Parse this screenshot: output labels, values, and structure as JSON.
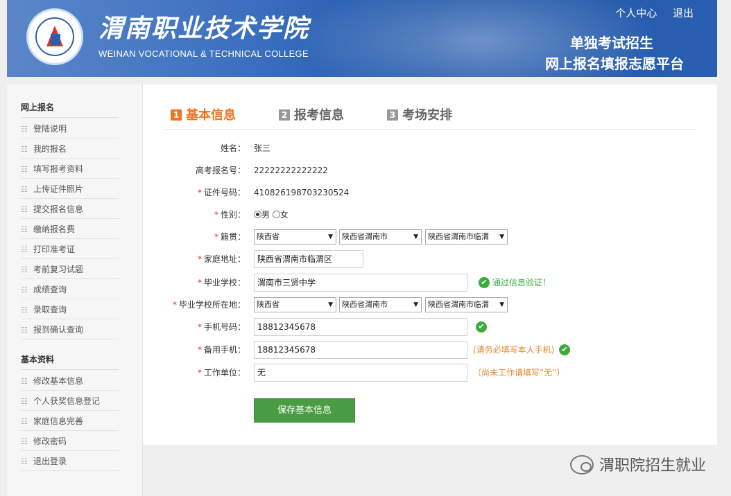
{
  "header": {
    "college_cn": "渭南职业技术学院",
    "college_en": "WEINAN VOCATIONAL & TECHNICAL COLLEGE",
    "links": [
      "个人中心",
      "退出"
    ],
    "slogan_line1": "单独考试招生",
    "slogan_line2": "网上报名填报志愿平台"
  },
  "sidebar": {
    "section1_title": "网上报名",
    "section1_items": [
      "登陆说明",
      "我的报名",
      "填写报考资料",
      "上传证件照片",
      "提交报名信息",
      "缴纳报名费",
      "打印准考证",
      "考前复习试题",
      "成绩查询",
      "录取查询",
      "报到确认查询"
    ],
    "section2_title": "基本资料",
    "section2_items": [
      "修改基本信息",
      "个人获奖信息登记",
      "家庭信息完善",
      "修改密码",
      "退出登录"
    ]
  },
  "steps": [
    {
      "num": "1",
      "label": "基本信息"
    },
    {
      "num": "2",
      "label": "报考信息"
    },
    {
      "num": "3",
      "label": "考场安排"
    }
  ],
  "form": {
    "name_label": "姓名：",
    "name_value": "张三",
    "exam_no_label": "高考报名号：",
    "exam_no_value": "22222222222222",
    "id_label": "证件号码：",
    "id_value": "410826198703230524",
    "gender_label": "性别：",
    "gender_male": "男",
    "gender_female": "女",
    "native_label": "籍贯：",
    "native_province": "陕西省",
    "native_city": "陕西省渭南市",
    "native_district": "陕西省渭南市临渭",
    "address_label": "家庭地址：",
    "address_value": "陕西省渭南市临渭区",
    "school_label": "毕业学校：",
    "school_value": "渭南市三贤中学",
    "school_ok": "通过信息验证！",
    "school_loc_label": "毕业学校所在地：",
    "school_province": "陕西省",
    "school_city": "陕西省渭南市",
    "school_district": "陕西省渭南市临渭",
    "phone_label": "手机号码：",
    "phone_value": "18812345678",
    "phone2_label": "备用手机：",
    "phone2_value": "18812345678",
    "phone2_hint": "(请务必填写本人手机)",
    "work_label": "工作单位：",
    "work_value": "无",
    "work_hint": "（尚未工作请填写“无”）",
    "save_label": "保存基本信息"
  },
  "watermark": "渭职院招生就业",
  "colors": {
    "accent": "#f0731f",
    "success": "#3caa3c",
    "button": "#4a9c44",
    "header": "#2a5fb0"
  }
}
